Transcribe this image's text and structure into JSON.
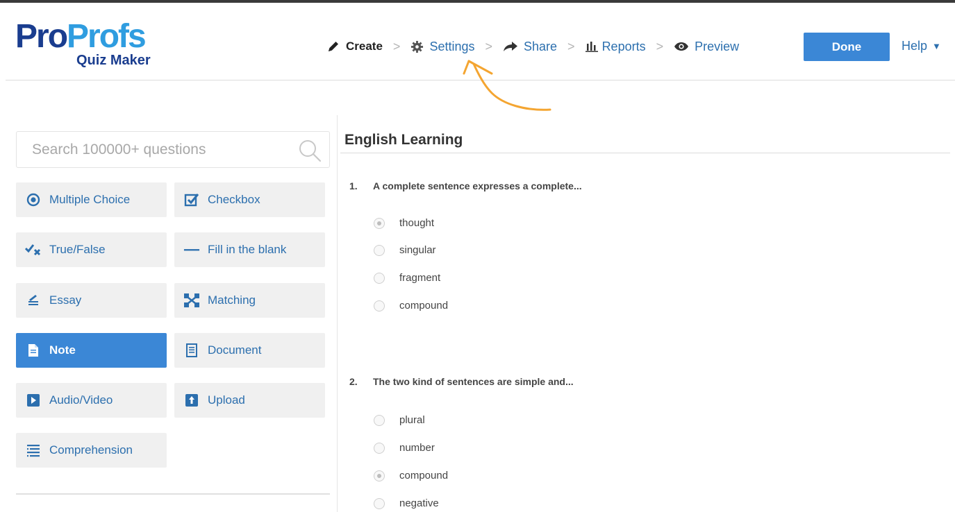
{
  "app": {
    "logo_brand_a": "Pro",
    "logo_brand_b": "Profs",
    "logo_sub": "Quiz Maker"
  },
  "nav": {
    "items": [
      {
        "label": "Create",
        "icon": "pencil-icon",
        "active": true
      },
      {
        "label": "Settings",
        "icon": "gear-icon",
        "active": false
      },
      {
        "label": "Share",
        "icon": "share-arrow-icon",
        "active": false
      },
      {
        "label": "Reports",
        "icon": "bar-chart-icon",
        "active": false
      },
      {
        "label": "Preview",
        "icon": "eye-icon",
        "active": false
      }
    ],
    "separator": ">",
    "done_label": "Done",
    "help_label": "Help",
    "help_caret": "▼"
  },
  "search": {
    "placeholder": "Search 100000+ questions"
  },
  "question_types": [
    {
      "label": "Multiple Choice",
      "icon": "radio-dot-icon"
    },
    {
      "label": "Checkbox",
      "icon": "checkbox-icon"
    },
    {
      "label": "True/False",
      "icon": "true-false-icon"
    },
    {
      "label": "Fill in the blank",
      "icon": "dash-icon"
    },
    {
      "label": "Essay",
      "icon": "essay-icon"
    },
    {
      "label": "Matching",
      "icon": "matching-icon"
    },
    {
      "label": "Note",
      "icon": "note-icon",
      "active": true
    },
    {
      "label": "Document",
      "icon": "document-icon"
    },
    {
      "label": "Audio/Video",
      "icon": "play-icon"
    },
    {
      "label": "Upload",
      "icon": "upload-icon"
    },
    {
      "label": "Comprehension",
      "icon": "comprehension-icon"
    }
  ],
  "quiz": {
    "title": "English Learning",
    "questions": [
      {
        "number": "1.",
        "text": "A complete sentence expresses a complete...",
        "options": [
          {
            "label": "thought",
            "selected": true
          },
          {
            "label": "singular",
            "selected": false
          },
          {
            "label": "fragment",
            "selected": false
          },
          {
            "label": "compound",
            "selected": false
          }
        ]
      },
      {
        "number": "2.",
        "text": "The two kind of sentences are simple and...",
        "options": [
          {
            "label": "plural",
            "selected": false
          },
          {
            "label": "number",
            "selected": false
          },
          {
            "label": "compound",
            "selected": true
          },
          {
            "label": "negative",
            "selected": false
          }
        ]
      }
    ]
  },
  "colors": {
    "accent": "#3b87d6",
    "link": "#2c6fae",
    "arrow": "#f4a531",
    "logo_dark": "#1a3d8f",
    "logo_light": "#2f9de0"
  }
}
